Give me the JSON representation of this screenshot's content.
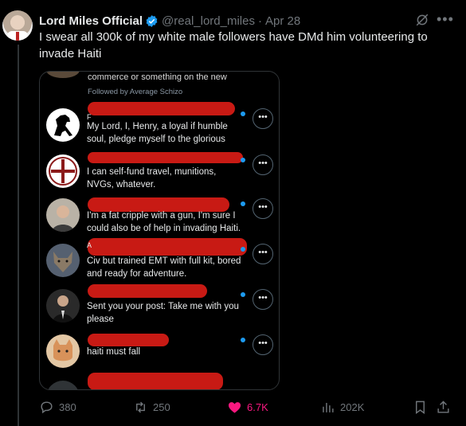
{
  "tweet": {
    "author_name": "Lord Miles Official",
    "handle": "@real_lord_miles",
    "separator": "·",
    "date": "Apr 28",
    "text": "I swear all 300k of my white male followers have DMd him volunteering to invade Haiti"
  },
  "screenshot": {
    "top_text": "commerce or something on the new",
    "followed_by": "Followed by Average Schizo",
    "rows": [
      {
        "prefix": "F",
        "text": "My Lord, I, Henry, a loyal if humble soul, pledge myself to the glorious",
        "avatar_icon": "horse-icon"
      },
      {
        "prefix": "",
        "text": "I can self-fund travel, munitions, NVGs, whatever.",
        "avatar_icon": "crusader-cross-icon"
      },
      {
        "prefix": "",
        "text": "I'm a fat cripple with a gun, I'm sure I could also be of help in invading Haiti.",
        "avatar_icon": "man-portrait-icon"
      },
      {
        "prefix": "A",
        "text": "Civ but trained EMT with full kit, bored and ready for adventure.",
        "avatar_icon": "wolf-icon"
      },
      {
        "prefix": "",
        "text": "Sent you your post: Take me with you please",
        "avatar_icon": "man-suit-icon"
      },
      {
        "prefix": "",
        "text": "haiti must fall",
        "avatar_icon": "cat-icon"
      }
    ],
    "more_label": "•••"
  },
  "actions": {
    "replies": "380",
    "reposts": "250",
    "likes": "6.7K",
    "views": "202K"
  },
  "colors": {
    "like": "#f91880",
    "verified": "#1d9bf0",
    "redaction": "#c81a14"
  }
}
